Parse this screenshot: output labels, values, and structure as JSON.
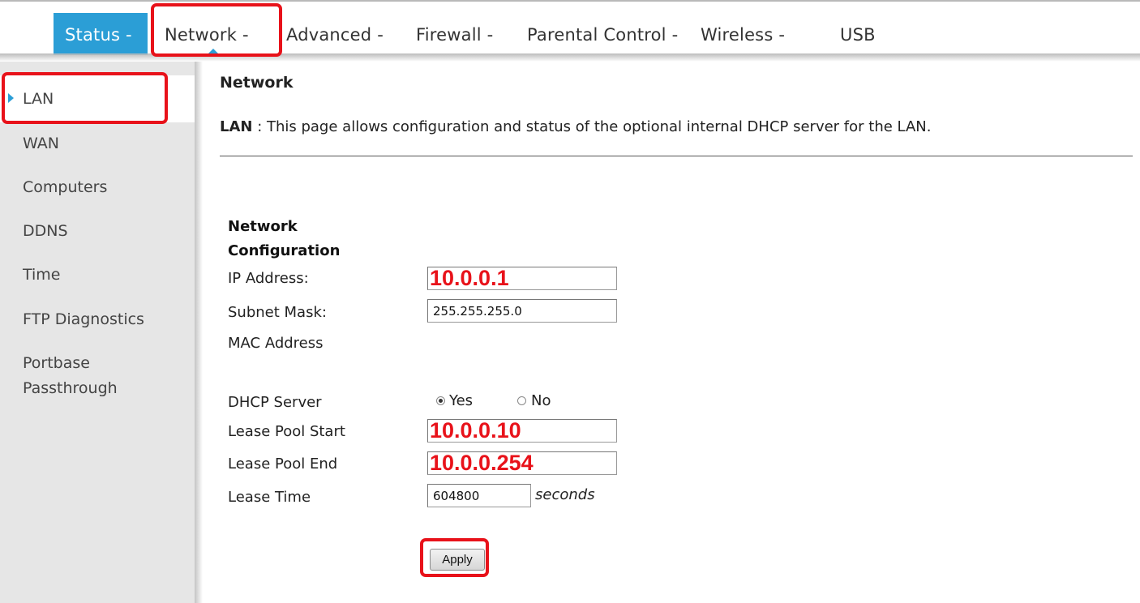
{
  "nav": {
    "items": [
      "Status -",
      "Network -",
      "Advanced -",
      "Firewall -",
      "Parental Control -",
      "Wireless -",
      "USB"
    ],
    "active": "Status -",
    "current": "Network -",
    "accent": "#2b9ed6"
  },
  "sidebar": {
    "items": [
      "LAN",
      "WAN",
      "Computers",
      "DDNS",
      "Time",
      "FTP Diagnostics",
      "Portbase",
      "Passthrough"
    ],
    "active": "LAN"
  },
  "page": {
    "title": "Network",
    "desc_label": "LAN",
    "desc_text": " :  This page allows configuration and status of the optional internal DHCP server for the LAN."
  },
  "config": {
    "heading_line1": "Network",
    "heading_line2": "Configuration",
    "ip_label": "IP Address:",
    "ip_value": "10.0.0.1",
    "subnet_label": "Subnet Mask:",
    "subnet_value": "255.255.255.0",
    "mac_label": "MAC Address",
    "dhcp_label": "DHCP Server",
    "dhcp_yes": "Yes",
    "dhcp_no": "No",
    "dhcp_selected": "Yes",
    "pool_start_label": "Lease Pool Start",
    "pool_start_value": "10.0.0.10",
    "pool_end_label": "Lease Pool End",
    "pool_end_value": "10.0.0.254",
    "lease_time_label": "Lease Time",
    "lease_time_value": "604800",
    "lease_time_unit": "seconds",
    "apply_label": "Apply"
  },
  "annotation_color": "#e8121a"
}
